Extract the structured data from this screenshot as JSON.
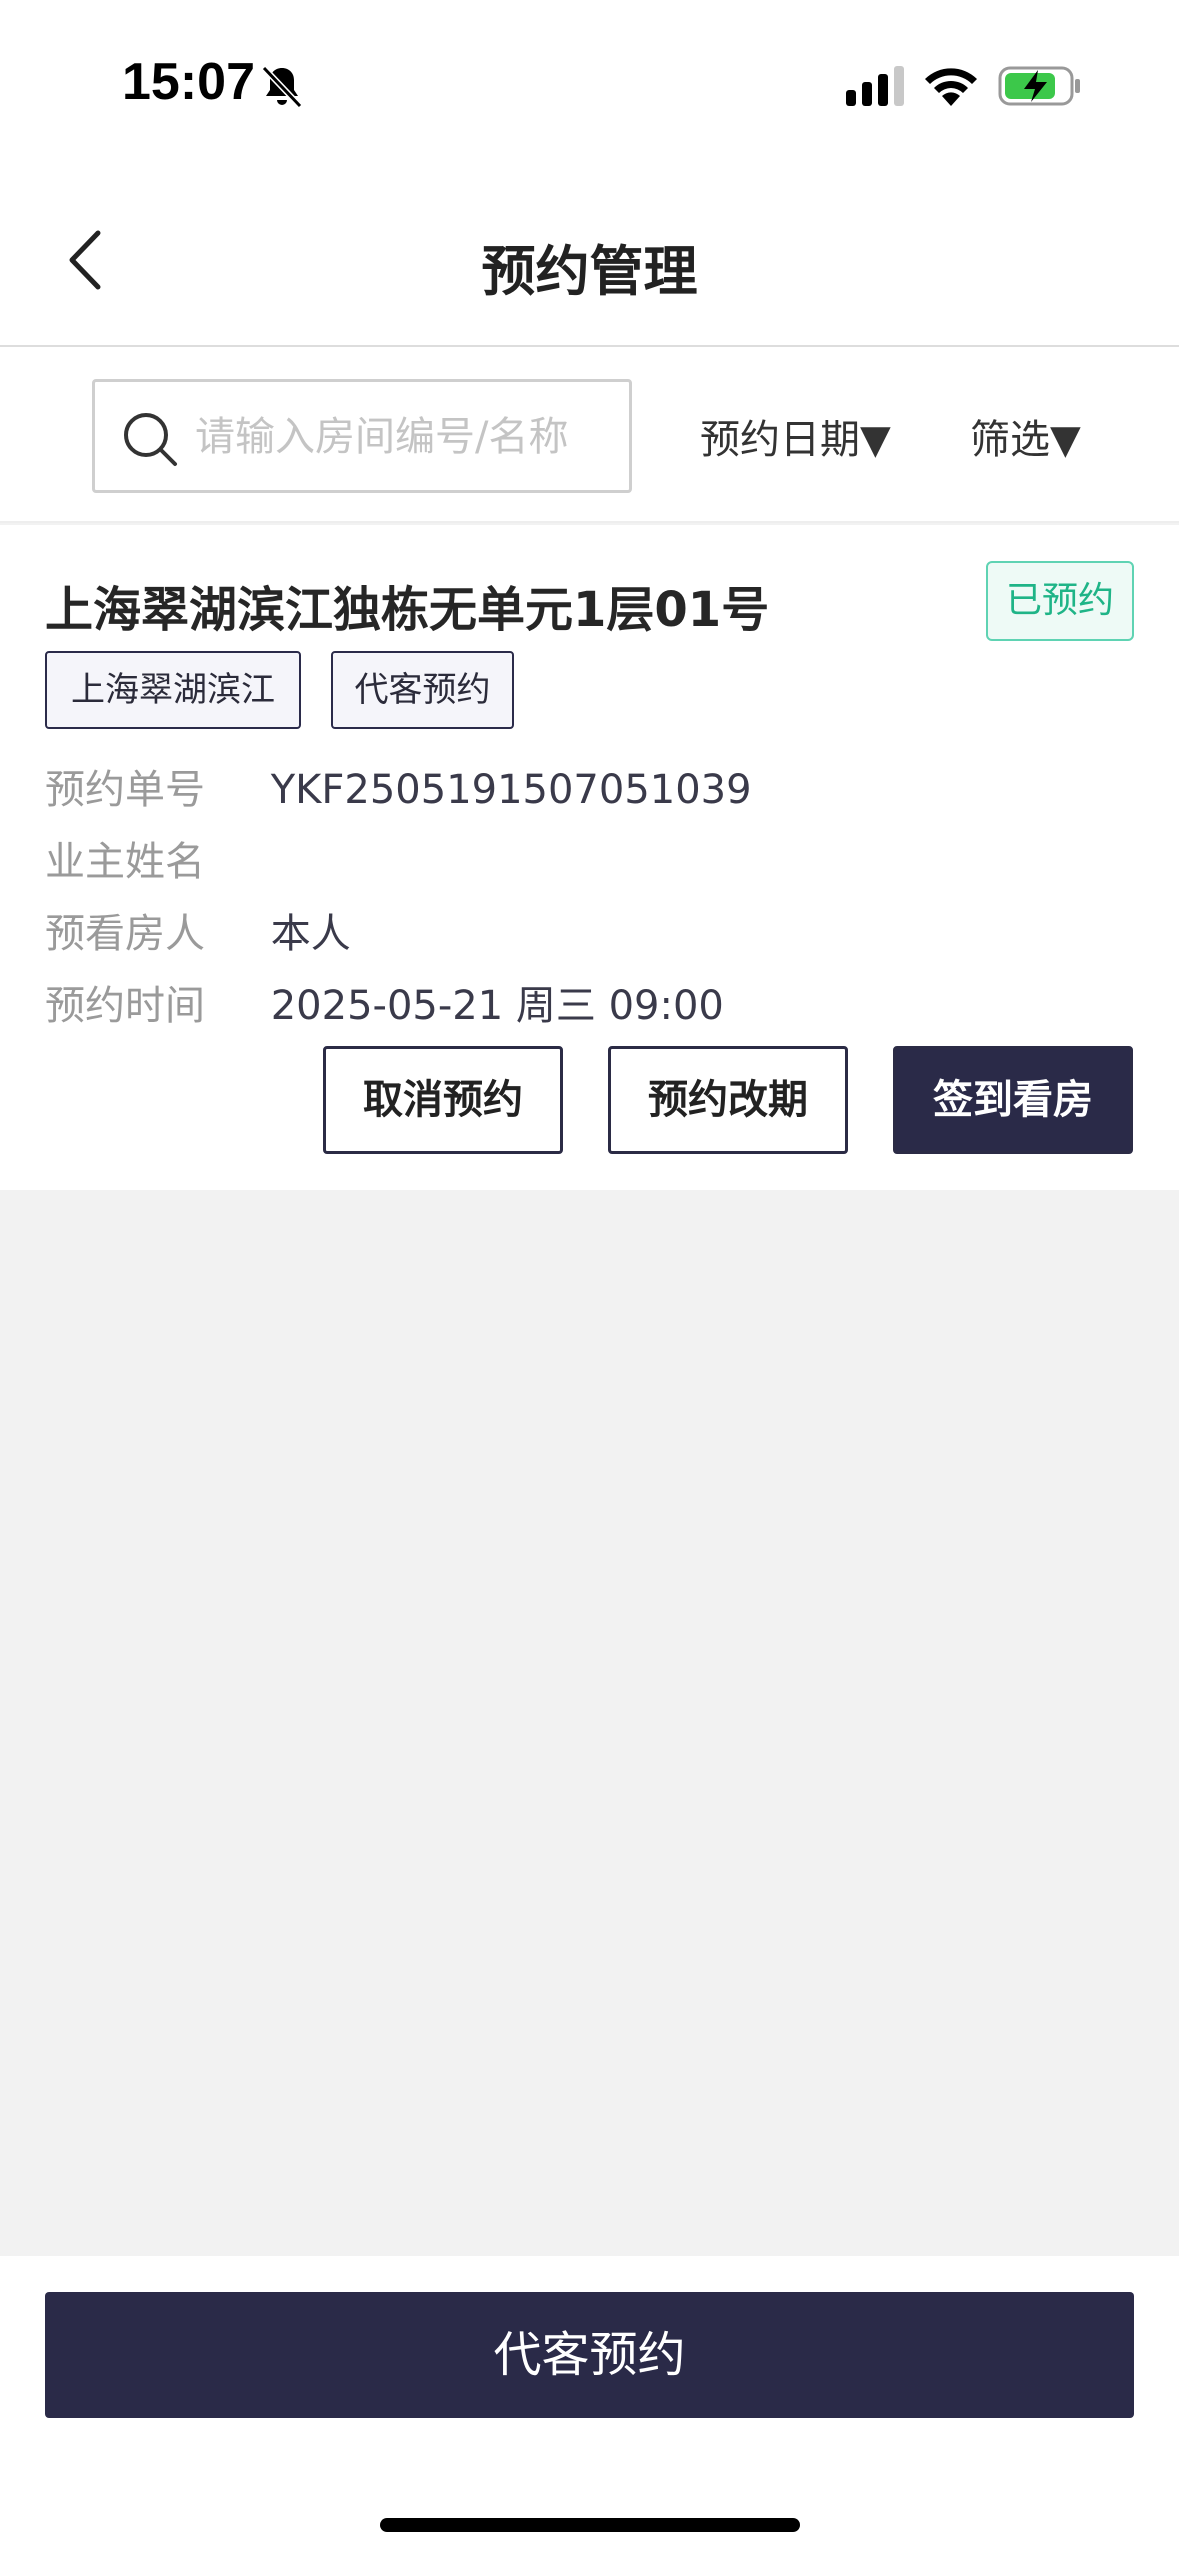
{
  "status_bar": {
    "time": "15:07"
  },
  "nav": {
    "title": "预约管理"
  },
  "search": {
    "placeholder": "请输入房间编号/名称",
    "value": ""
  },
  "filters": {
    "date_label": "预约日期▼",
    "filter_label": "筛选▼"
  },
  "appointment": {
    "room_title": "上海翠湖滨江独栋无单元1层01号",
    "status": "已预约",
    "tags": [
      "上海翠湖滨江",
      "代客预约"
    ],
    "fields": [
      {
        "label": "预约单号",
        "value": "YKF2505191507051039"
      },
      {
        "label": "业主姓名",
        "value": ""
      },
      {
        "label": "预看房人",
        "value": "本人"
      },
      {
        "label": "预约时间",
        "value": "2025-05-21 周三 09:00"
      }
    ],
    "actions": {
      "cancel": "取消预约",
      "reschedule": "预约改期",
      "checkin": "签到看房"
    }
  },
  "bottom": {
    "button_label": "代客预约"
  },
  "colors": {
    "primary": "#2a2a48",
    "status_green": "#1fb487",
    "background": "#f2f2f2"
  }
}
